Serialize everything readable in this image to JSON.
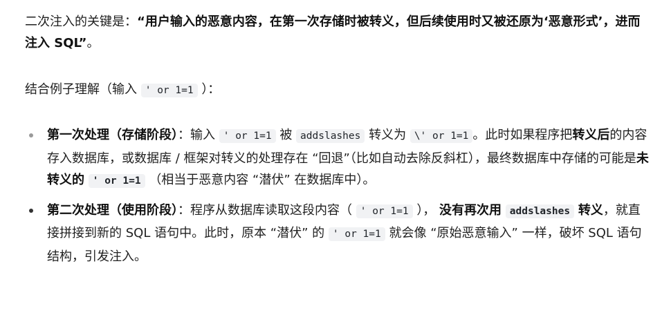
{
  "intro": {
    "lead": "二次注入的关键是：",
    "bold_line": "“用户输入的恶意内容，在第一次存储时被转义，但后续使用时又被还原为‘恶意形式’，进而注入 SQL”",
    "tail": "。"
  },
  "example": {
    "lead": "结合例子理解（输入",
    "code": "' or 1=1",
    "tail": "）："
  },
  "items": [
    {
      "title": "第一次处理（存储阶段）",
      "t1": "：输入",
      "c1": "' or 1=1",
      "t2": "被",
      "c2": "addslashes",
      "t3": "转义为",
      "c3": "\\' or 1=1",
      "t4": "。此时如果程序把",
      "b1": "转义后",
      "t5": "的内容存入数据库，或数据库 / 框架对转义的处理存在 “回退”（比如自动去除反斜杠），最终数据库中存储的可能是",
      "b2": "未转义的",
      "c4": "' or 1=1",
      "t6": "（相当于恶意内容 “潜伏” 在数据库中）。"
    },
    {
      "title": "第二次处理（使用阶段）",
      "t1": "：程序从数据库读取这段内容（",
      "c1": "' or 1=1",
      "t2": "），",
      "b1": "没有再次用",
      "c2": "addslashes",
      "b2": "转义",
      "t3": "，就直接拼接到新的 SQL 语句中。此时，原本 “潜伏” 的",
      "c3": "' or 1=1",
      "t4": "就会像 “原始恶意输入” 一样，破坏 SQL 语句结构，引发注入。"
    }
  ]
}
